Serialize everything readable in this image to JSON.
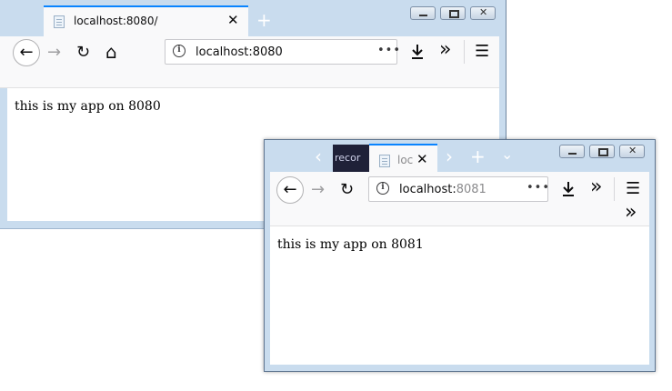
{
  "window1": {
    "tab": {
      "title": "localhost:8080/"
    },
    "url": {
      "host": "localhost:8080",
      "port": ""
    },
    "content": "this is my app on 8080"
  },
  "window2": {
    "prev_tab": {
      "title": "recor"
    },
    "tab": {
      "title": "loc"
    },
    "url": {
      "host": "localhost:",
      "port": "8081"
    },
    "content": "this is my app on 8081"
  },
  "icons": {
    "back": "←",
    "forward": "→",
    "reload": "↻",
    "home": "⌂",
    "close": "✕",
    "new_tab": "+",
    "page_actions": "•••",
    "download": "download-icon",
    "overflow": "»",
    "menu": "☰",
    "scroll_left": "‹",
    "scroll_right": "›",
    "tab_list": "⌄"
  },
  "colors": {
    "accent": "#0a84ff",
    "chrome": "#c9dcee",
    "toolbar": "#f9f9fa"
  }
}
